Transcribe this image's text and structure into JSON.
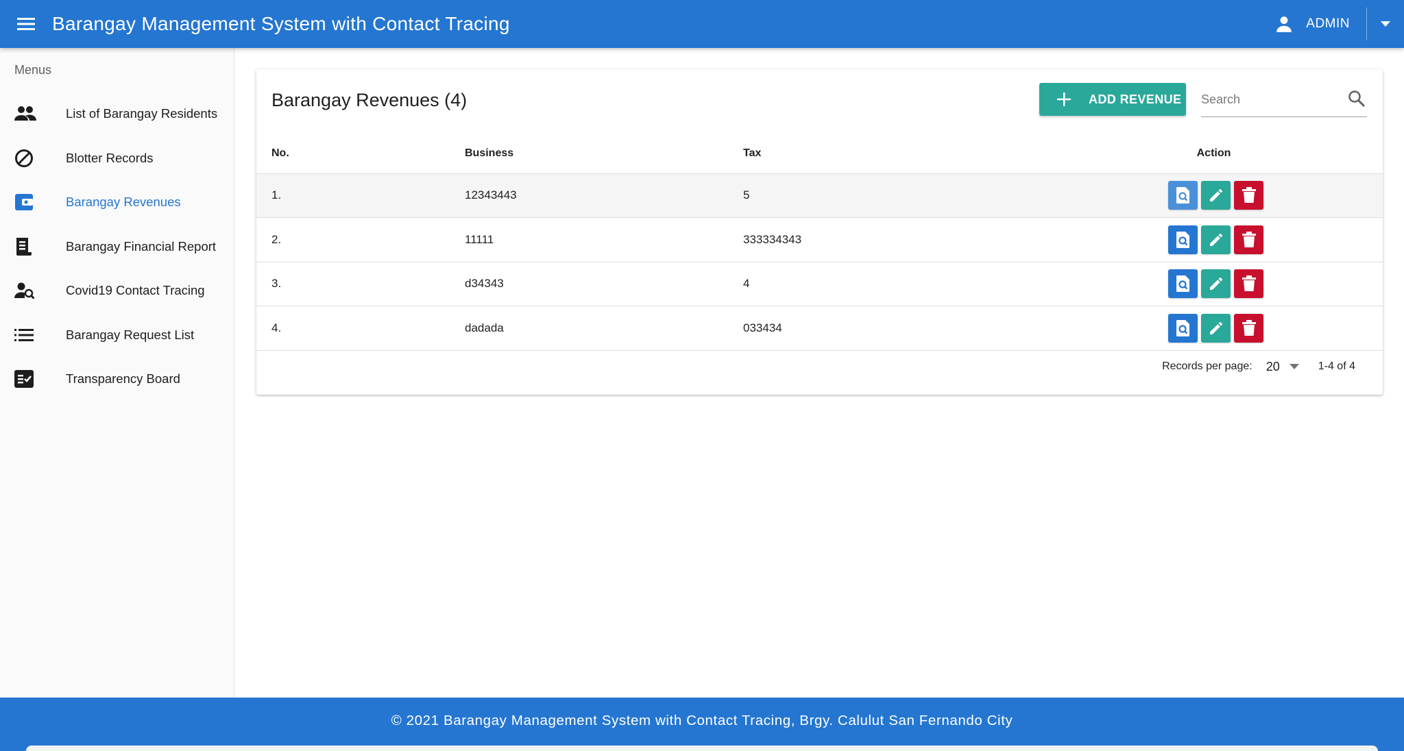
{
  "app": {
    "title": "Barangay Management System with Contact Tracing",
    "user": "ADMIN"
  },
  "colors": {
    "primary": "#2476d1",
    "teal": "#2aa89a",
    "danger": "#c8102e"
  },
  "sidebar": {
    "header": "Menus",
    "items": [
      {
        "label": "List of Barangay Residents",
        "icon": "people-icon"
      },
      {
        "label": "Blotter Records",
        "icon": "block-icon"
      },
      {
        "label": "Barangay Revenues",
        "icon": "wallet-icon",
        "active": true
      },
      {
        "label": "Barangay Financial Report",
        "icon": "receipt-icon"
      },
      {
        "label": "Covid19 Contact Tracing",
        "icon": "person-search-icon"
      },
      {
        "label": "Barangay Request List",
        "icon": "list-icon"
      },
      {
        "label": "Transparency Board",
        "icon": "fact-check-icon"
      }
    ]
  },
  "main": {
    "title": "Barangay Revenues (4)",
    "add_button": "ADD REVENUE",
    "search_placeholder": "Search",
    "table": {
      "headers": [
        "No.",
        "Business",
        "Tax",
        "Action"
      ],
      "rows": [
        {
          "no": "1.",
          "business": "12343443",
          "tax": "5"
        },
        {
          "no": "2.",
          "business": "11111",
          "tax": "333334343"
        },
        {
          "no": "3.",
          "business": "d34343",
          "tax": "4"
        },
        {
          "no": "4.",
          "business": "dadada",
          "tax": "033434"
        }
      ]
    },
    "pagination": {
      "label": "Records per page:",
      "per_page": "20",
      "range": "1-4 of 4"
    }
  },
  "footer": {
    "text": "© 2021 Barangay Management System with Contact Tracing, Brgy. Calulut San Fernando City"
  }
}
